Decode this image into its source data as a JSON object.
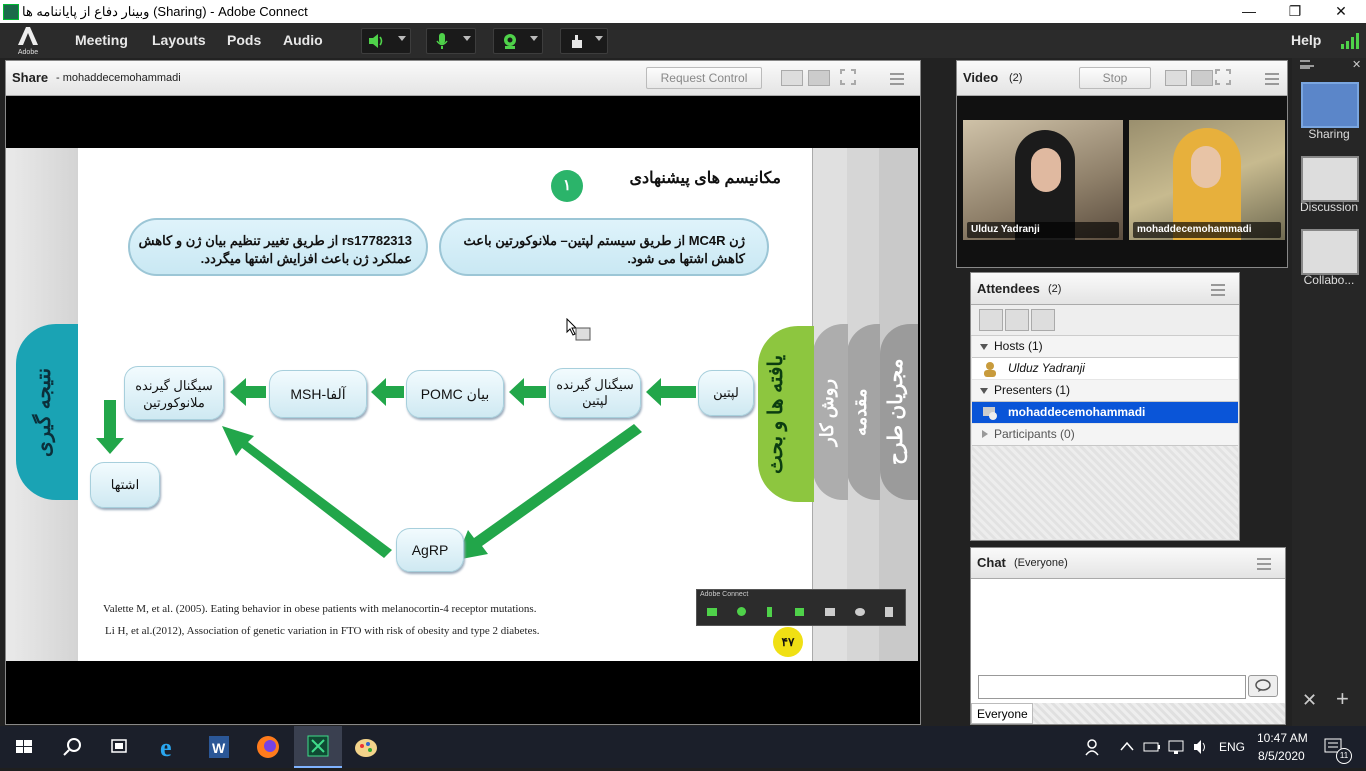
{
  "window": {
    "title": "وبینار دفاع از پایاننامه ها (Sharing) - Adobe Connect",
    "minimize": "—",
    "restore": "❐",
    "close": "✕"
  },
  "menubar": {
    "logo_text": "Adobe",
    "items": [
      "Meeting",
      "Layouts",
      "Pods",
      "Audio"
    ],
    "help": "Help"
  },
  "share_pod": {
    "title": "Share",
    "presenter": "- mohaddecemohammadi",
    "request_control": "Request Control"
  },
  "slide": {
    "heading": "مکانیسم های پیشنهادی",
    "badge_number": "۱",
    "bubble_right": "ژن MC4R از طریق سیستم لپتین– ملانوکورتین باعث کاهش اشتها می شود.",
    "bubble_left": "rs17782313  از طریق تغییر تنظیم بیان ژن و کاهش عملکرد ژن باعث افزایش اشتها میگردد.",
    "nodes": {
      "leptin": "لپتین",
      "leptin_signal": "سیگنال گیرنده لپتین",
      "pomc": "بیان POMC",
      "msh": "MSH-آلفا",
      "melano_signal": "سیگنال گیرنده ملانوکورتین",
      "appetite": "اشتها",
      "agrp": "AgRP"
    },
    "tabs": {
      "findings": "یافته ها و بحث",
      "methods": "روش کار",
      "intro": "مقدمه",
      "team": "مجریان طرح",
      "conclusion": "نتیجه گیری"
    },
    "references": [
      "Valette M, et al. (2005). Eating behavior in obese patients with melanocortin-4 receptor mutations.",
      "Li H, et al.(2012), Association of genetic variation in FTO with risk of obesity and type 2 diabetes."
    ],
    "page_number": "۴۷",
    "mini_toolbar_title": "Adobe Connect"
  },
  "video_pod": {
    "title": "Video",
    "count": "(2)",
    "stop": "Stop",
    "participants": [
      "Ulduz Yadranji",
      "mohaddecemohammadi"
    ]
  },
  "attendees_pod": {
    "title": "Attendees",
    "count": "(2)",
    "groups": {
      "hosts": "Hosts (1)",
      "host_name": "Ulduz Yadranji",
      "presenters": "Presenters (1)",
      "presenter_name": "mohaddecemohammadi",
      "participants": "Participants (0)"
    }
  },
  "chat_pod": {
    "title": "Chat",
    "scope": "(Everyone)",
    "recipient": "Everyone",
    "input_value": ""
  },
  "layouts": [
    "Sharing",
    "Discussion",
    "Collabo..."
  ],
  "taskbar": {
    "lang": "ENG",
    "time": "10:47 AM",
    "date": "8/5/2020",
    "notifications": "11"
  },
  "colors": {
    "accent_selected": "#0a55d8",
    "slide_green": "#2bb46a",
    "findings_tab": "#8dc63f",
    "conclusion_tab": "#1aa3b4"
  }
}
